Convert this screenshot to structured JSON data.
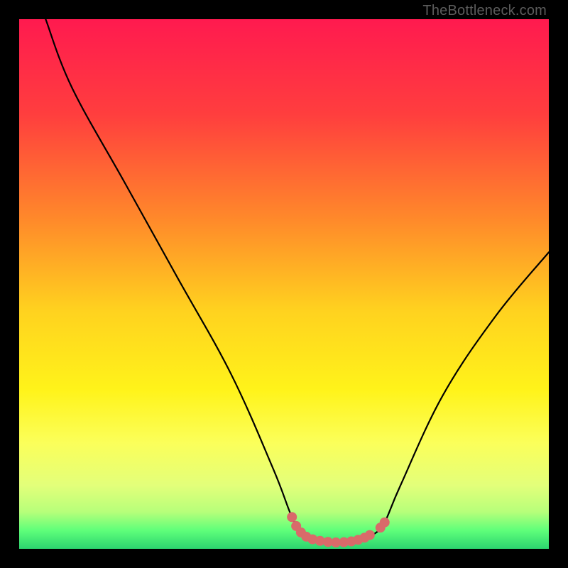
{
  "watermark": "TheBottleneck.com",
  "colors": {
    "black": "#000000",
    "curve": "#000000",
    "marker": "#d96a6a",
    "marker_stroke": "#c95a5a"
  },
  "chart_data": {
    "type": "line",
    "title": "",
    "xlabel": "",
    "ylabel": "",
    "xlim": [
      0,
      100
    ],
    "ylim": [
      0,
      100
    ],
    "gradient_stops": [
      {
        "pos": 0.0,
        "color": "#ff1a4f"
      },
      {
        "pos": 0.18,
        "color": "#ff3e3e"
      },
      {
        "pos": 0.38,
        "color": "#ff8a2a"
      },
      {
        "pos": 0.55,
        "color": "#ffd21f"
      },
      {
        "pos": 0.7,
        "color": "#fff31a"
      },
      {
        "pos": 0.8,
        "color": "#fbff5a"
      },
      {
        "pos": 0.88,
        "color": "#e3ff7a"
      },
      {
        "pos": 0.93,
        "color": "#b7ff7a"
      },
      {
        "pos": 0.965,
        "color": "#5fff7a"
      },
      {
        "pos": 1.0,
        "color": "#2cd46f"
      }
    ],
    "series": [
      {
        "name": "bottleneck-curve",
        "points": [
          {
            "x": 5.0,
            "y": 100.0
          },
          {
            "x": 10.0,
            "y": 87.0
          },
          {
            "x": 20.0,
            "y": 69.0
          },
          {
            "x": 30.0,
            "y": 51.0
          },
          {
            "x": 40.0,
            "y": 33.0
          },
          {
            "x": 48.0,
            "y": 15.0
          },
          {
            "x": 51.5,
            "y": 6.0
          },
          {
            "x": 53.5,
            "y": 3.0
          },
          {
            "x": 56.0,
            "y": 1.8
          },
          {
            "x": 60.0,
            "y": 1.2
          },
          {
            "x": 64.0,
            "y": 1.4
          },
          {
            "x": 67.0,
            "y": 2.8
          },
          {
            "x": 69.0,
            "y": 5.0
          },
          {
            "x": 72.0,
            "y": 12.0
          },
          {
            "x": 80.0,
            "y": 29.0
          },
          {
            "x": 90.0,
            "y": 44.0
          },
          {
            "x": 100.0,
            "y": 56.0
          }
        ]
      }
    ],
    "markers": {
      "name": "curve-bottom-highlight",
      "points": [
        {
          "x": 51.5,
          "y": 6.0
        },
        {
          "x": 52.3,
          "y": 4.3
        },
        {
          "x": 53.2,
          "y": 3.1
        },
        {
          "x": 54.2,
          "y": 2.3
        },
        {
          "x": 55.4,
          "y": 1.8
        },
        {
          "x": 56.8,
          "y": 1.5
        },
        {
          "x": 58.3,
          "y": 1.3
        },
        {
          "x": 59.8,
          "y": 1.2
        },
        {
          "x": 61.3,
          "y": 1.25
        },
        {
          "x": 62.7,
          "y": 1.4
        },
        {
          "x": 64.0,
          "y": 1.7
        },
        {
          "x": 65.2,
          "y": 2.1
        },
        {
          "x": 66.2,
          "y": 2.6
        },
        {
          "x": 68.2,
          "y": 4.0
        },
        {
          "x": 69.0,
          "y": 5.0
        }
      ],
      "radius": 7
    }
  }
}
